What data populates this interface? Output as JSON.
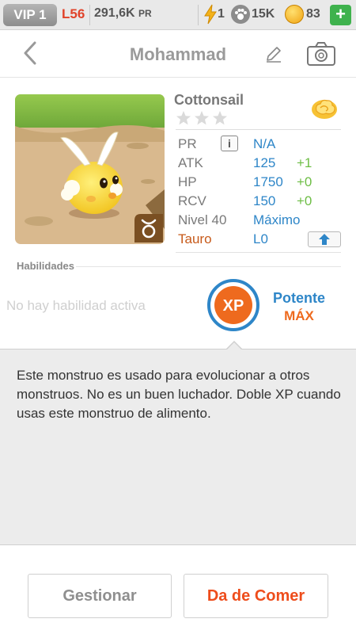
{
  "status_bar": {
    "vip": "VIP 1",
    "level": "L56",
    "pr_value": "291,6K",
    "pr_unit": "PR",
    "energy": "1",
    "paw_count": "15K",
    "coins": "83",
    "add_label": "+"
  },
  "nav": {
    "title": "Mohammad",
    "icons": [
      "chevron-left-icon",
      "pencil-icon",
      "camera-icon"
    ]
  },
  "monster": {
    "name": "Cottonsail",
    "stars": 3,
    "element_icon": "cloud-icon",
    "zodiac_icon": "taurus-icon",
    "stats": [
      {
        "label": "PR",
        "value": "N/A",
        "bonus": ""
      },
      {
        "label": "ATK",
        "value": "125",
        "bonus": "+1"
      },
      {
        "label": "HP",
        "value": "1750",
        "bonus": "+0"
      },
      {
        "label": "RCV",
        "value": "150",
        "bonus": "+0"
      },
      {
        "label": "Nivel 40",
        "value": "Máximo",
        "bonus": ""
      },
      {
        "label": "Tauro",
        "value": "L0",
        "bonus": ""
      }
    ],
    "info_label": "i"
  },
  "abilities": {
    "header": "Habilidades",
    "none_text": "No hay habilidad activa",
    "xp_label": "XP",
    "power_label": "Potente",
    "max_label": "MÁX"
  },
  "description": "Este monstruo es usado para evolucionar a otros monstruos. No es un buen luchador. Doble XP cuando usas este monstruo de alimento.",
  "buttons": {
    "manage": "Gestionar",
    "feed": "Da de Comer"
  },
  "colors": {
    "accent_blue": "#2e86c8",
    "bonus_green": "#6dbd45",
    "feed_orange": "#ee4d1c",
    "level_red": "#e0432a"
  }
}
